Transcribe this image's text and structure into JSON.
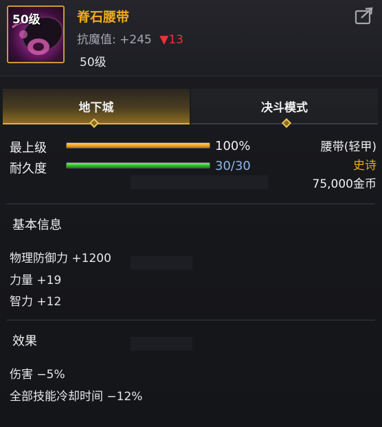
{
  "item": {
    "level_badge": "50级",
    "name": "脊石腰带",
    "resist_label": "抗魔值:",
    "resist_value": "+245",
    "resist_delta_icon": "down-triangle-icon",
    "resist_delta": "13",
    "required_level": "50级"
  },
  "tabs": [
    {
      "label": "地下城",
      "active": true
    },
    {
      "label": "决斗模式",
      "active": false
    }
  ],
  "stats": {
    "grade_label": "最上级",
    "grade_value": "100%",
    "grade_percent": 100,
    "durability_label": "耐久度",
    "durability_value": "30/30",
    "durability_percent": 100
  },
  "meta": {
    "type": "腰带(轻甲)",
    "rarity": "史诗",
    "price": "75,000金币"
  },
  "basic_info": {
    "title": "基本信息",
    "lines": [
      "物理防御力 +1200",
      "力量 +19",
      "智力 +12"
    ]
  },
  "effects": {
    "title": "效果",
    "lines": [
      "伤害 −5%",
      "全部技能冷却时间 −12%"
    ]
  },
  "colors": {
    "item_name": "#f0a91c",
    "rarity": "#f0a91c",
    "resist_delta": "#e8333a",
    "durability_text": "#8fb6e6",
    "frame_gold": "#c99a3a"
  },
  "icons": {
    "item": "belt-item-icon",
    "share": "share-icon"
  }
}
